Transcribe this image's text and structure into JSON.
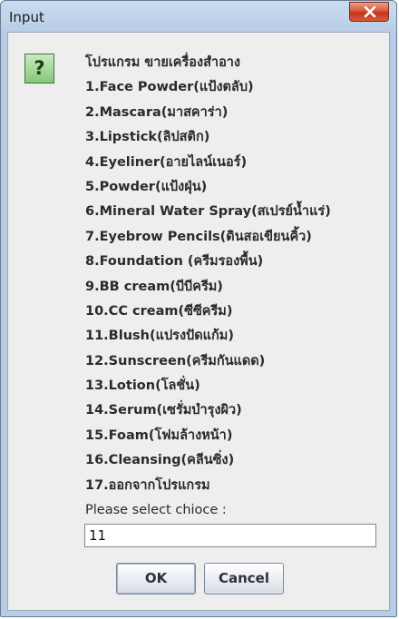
{
  "window": {
    "title": "Input"
  },
  "icon": {
    "glyph": "?",
    "name": "question-icon"
  },
  "message": {
    "lines": [
      "โปรแกรม ขายเครื่องสำอาง",
      "1.Face Powder(แป้งตลับ)",
      "2.Mascara(มาสคาร่า)",
      "3.Lipstick(ลิปสติก)",
      "4.Eyeliner(อายไลน์เนอร์)",
      "5.Powder(แป้งฝุ่น)",
      "6.Mineral Water Spray(สเปรย์น้ำแร่)",
      "7.Eyebrow Pencils(ดินสอเขียนคิ้ว)",
      "8.Foundation (ครีมรองพื้น)",
      "9.BB cream(บีบีครีม)",
      "10.CC cream(ซีซีครีม)",
      "11.Blush(แปรงปัดแก้ม)",
      "12.Sunscreen(ครีมกันแดด)",
      "13.Lotion(โลชั่น)",
      "14.Serum(เซรั่มบำรุงผิว)",
      "15.Foam(โฟมล้างหน้า)",
      "16.Cleansing(คลีนซิ่ง)",
      "17.ออกจากโปรแกรม"
    ]
  },
  "prompt": "Please select chioce :",
  "input": {
    "value": "11"
  },
  "buttons": {
    "ok": "OK",
    "cancel": "Cancel"
  },
  "colors": {
    "titlebar": "#b7cde6",
    "close": "#c7341b",
    "icon_bg": "#84c979"
  }
}
